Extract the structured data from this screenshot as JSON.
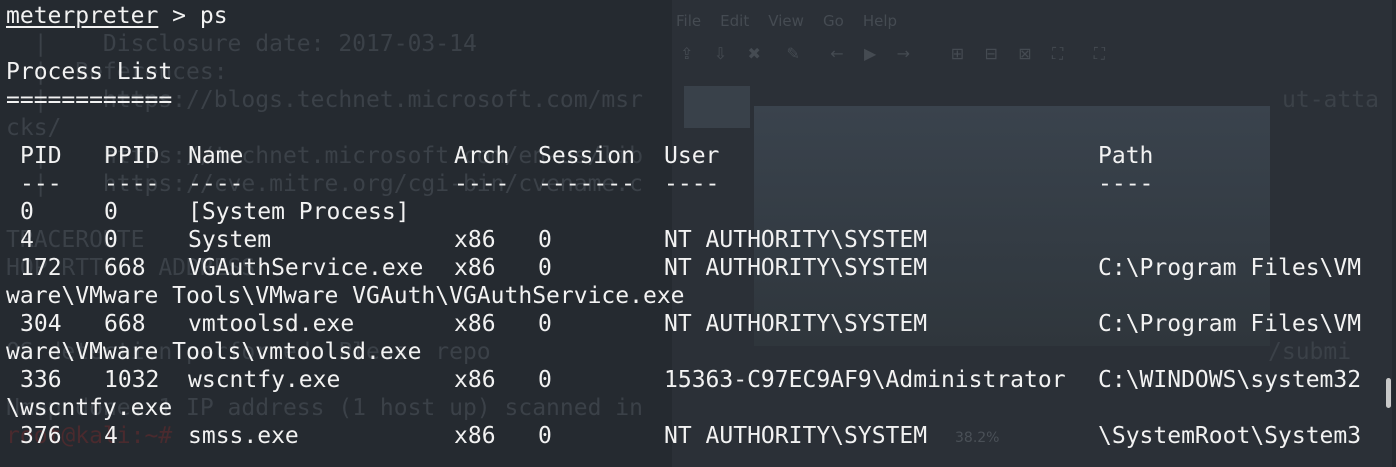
{
  "terminal": {
    "prompt_word": "meterpreter",
    "prompt_rest": " > ps",
    "list_title": "Process List",
    "underline": "============"
  },
  "table": {
    "headers": [
      "PID",
      "PPID",
      "Name",
      "Arch",
      "Session",
      "User",
      "Path"
    ],
    "dashes": [
      "---",
      "----",
      "----",
      "----",
      "-------",
      "----",
      "----"
    ],
    "rows": [
      {
        "pid": "0",
        "ppid": "0",
        "name": "[System Process]",
        "arch": "",
        "session": "",
        "user": "",
        "path": ""
      },
      {
        "pid": "4",
        "ppid": "0",
        "name": "System",
        "arch": "x86",
        "session": "0",
        "user": "NT AUTHORITY\\SYSTEM",
        "path": ""
      },
      {
        "pid": "172",
        "ppid": "668",
        "name": "VGAuthService.exe",
        "arch": "x86",
        "session": "0",
        "user": "NT AUTHORITY\\SYSTEM",
        "path": "C:\\Program Files\\VM"
      },
      {
        "pid": "304",
        "ppid": "668",
        "name": "vmtoolsd.exe",
        "arch": "x86",
        "session": "0",
        "user": "NT AUTHORITY\\SYSTEM",
        "path": "C:\\Program Files\\VM"
      },
      {
        "pid": "336",
        "ppid": "1032",
        "name": "wscntfy.exe",
        "arch": "x86",
        "session": "0",
        "user": "15363-C97EC9AF9\\Administrator",
        "path": "C:\\WINDOWS\\system32"
      },
      {
        "pid": "376",
        "ppid": "4",
        "name": "smss.exe",
        "arch": "x86",
        "session": "0",
        "user": "NT AUTHORITY\\SYSTEM",
        "path": "\\SystemRoot\\System3"
      }
    ],
    "wraps": [
      "ware\\VMware Tools\\VMware VGAuth\\VGAuthService.exe",
      "ware\\VMware Tools\\vmtoolsd.exe",
      "\\wscntfy.exe"
    ]
  },
  "background": {
    "lines": [
      "  |    Disclosure date: 2017-03-14",
      "  |  References:",
      "  |    https://blogs.technet.microsoft.com/msr",
      "cks/",
      "  |    https://technet.microsoft.com/en-us/lib",
      "  |    https://cve.mitre.org/cgi-bin/cvename.c",
      "TRACEROUTE",
      "HOP RTT    ADDRESS",
      "OS detection performed. Please repo",
      "Nmap done: 1 IP address (1 host up) scanned in",
      "root@kali:~# "
    ],
    "tail_right_1": "ut-atta",
    "tail_right_2": "/submi",
    "menubar": "File    Edit    View    Go    Help",
    "zoom": "38.2%"
  },
  "colors": {
    "background": "#252a30",
    "foreground": "#f2f2f2",
    "ghost_text": "#3b4148"
  }
}
